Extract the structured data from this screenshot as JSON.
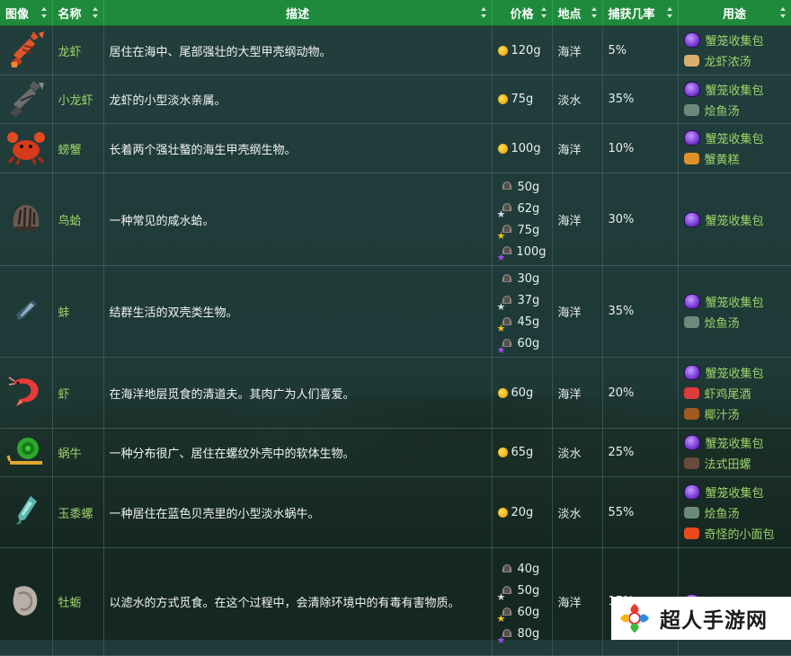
{
  "headers": {
    "image": "图像",
    "name": "名称",
    "desc": "描述",
    "price": "价格",
    "location": "地点",
    "catch_rate": "捕获几率",
    "uses": "用途"
  },
  "colors": {
    "header_bg": "#1f8a3c",
    "name_text": "#9ed36a",
    "use_text": "#9ed36a",
    "coin": "#f2a90f",
    "star_silver": "#d8dde6",
    "star_gold": "#f6c21a",
    "star_iridium": "#a34ee8"
  },
  "rows": [
    {
      "icon": "lobster-icon",
      "name": "龙虾",
      "desc": "居住在海中、尾部强壮的大型甲壳纲动物。",
      "prices": [
        {
          "quality": "base",
          "value": "120g"
        }
      ],
      "location": "海洋",
      "catch_rate": "5%",
      "uses": [
        {
          "icon": "crab-pot-icon",
          "label": "蟹笼收集包"
        },
        {
          "icon": "lobster-bisque-icon",
          "label": "龙虾浓汤"
        }
      ]
    },
    {
      "icon": "crayfish-icon",
      "name": "小龙虾",
      "desc": "龙虾的小型淡水亲属。",
      "prices": [
        {
          "quality": "base",
          "value": "75g"
        }
      ],
      "location": "淡水",
      "catch_rate": "35%",
      "uses": [
        {
          "icon": "crab-pot-icon",
          "label": "蟹笼收集包"
        },
        {
          "icon": "fish-stew-icon",
          "label": "烩鱼汤"
        }
      ]
    },
    {
      "icon": "crab-icon",
      "name": "螃蟹",
      "desc": "长着两个强壮螯的海生甲壳纲生物。",
      "prices": [
        {
          "quality": "base",
          "value": "100g"
        }
      ],
      "location": "海洋",
      "catch_rate": "10%",
      "uses": [
        {
          "icon": "crab-pot-icon",
          "label": "蟹笼收集包"
        },
        {
          "icon": "crab-cakes-icon",
          "label": "蟹黄糕"
        }
      ]
    },
    {
      "icon": "cockle-icon",
      "name": "鸟蛤",
      "desc": "一种常见的咸水蛤。",
      "prices": [
        {
          "quality": "base",
          "value": "50g"
        },
        {
          "quality": "silver",
          "value": "62g"
        },
        {
          "quality": "gold",
          "value": "75g"
        },
        {
          "quality": "iridium",
          "value": "100g"
        }
      ],
      "location": "海洋",
      "catch_rate": "30%",
      "uses": [
        {
          "icon": "crab-pot-icon",
          "label": "蟹笼收集包"
        }
      ]
    },
    {
      "icon": "mussel-icon",
      "name": "蚌",
      "desc": "结群生活的双壳类生物。",
      "prices": [
        {
          "quality": "base",
          "value": "30g"
        },
        {
          "quality": "silver",
          "value": "37g"
        },
        {
          "quality": "gold",
          "value": "45g"
        },
        {
          "quality": "iridium",
          "value": "60g"
        }
      ],
      "location": "海洋",
      "catch_rate": "35%",
      "uses": [
        {
          "icon": "crab-pot-icon",
          "label": "蟹笼收集包"
        },
        {
          "icon": "fish-stew-icon",
          "label": "烩鱼汤"
        }
      ]
    },
    {
      "icon": "shrimp-icon",
      "name": "虾",
      "desc": "在海洋地层觅食的清道夫。其肉广为人们喜爱。",
      "prices": [
        {
          "quality": "base",
          "value": "60g"
        }
      ],
      "location": "海洋",
      "catch_rate": "20%",
      "uses": [
        {
          "icon": "crab-pot-icon",
          "label": "蟹笼收集包"
        },
        {
          "icon": "shrimp-cocktail-icon",
          "label": "虾鸡尾酒"
        },
        {
          "icon": "coconut-soup-icon",
          "label": "椰汁汤"
        }
      ]
    },
    {
      "icon": "snail-icon",
      "name": "蜗牛",
      "desc": "一种分布很广、居住在螺纹外壳中的软体生物。",
      "prices": [
        {
          "quality": "base",
          "value": "65g"
        }
      ],
      "location": "淡水",
      "catch_rate": "25%",
      "uses": [
        {
          "icon": "crab-pot-icon",
          "label": "蟹笼收集包"
        },
        {
          "icon": "escargot-icon",
          "label": "法式田螺"
        }
      ]
    },
    {
      "icon": "periwinkle-icon",
      "name": "玉黍螺",
      "desc": "一种居住在蓝色贝壳里的小型淡水蜗牛。",
      "prices": [
        {
          "quality": "base",
          "value": "20g"
        }
      ],
      "location": "淡水",
      "catch_rate": "55%",
      "uses": [
        {
          "icon": "crab-pot-icon",
          "label": "蟹笼收集包"
        },
        {
          "icon": "fish-stew-icon",
          "label": "烩鱼汤"
        },
        {
          "icon": "strange-bun-icon",
          "label": "奇怪的小面包"
        }
      ]
    },
    {
      "icon": "oyster-icon",
      "name": "牡蛎",
      "desc": "以滤水的方式觅食。在这个过程中，会清除环境中的有毒有害物质。",
      "prices": [
        {
          "quality": "base",
          "value": "40g"
        },
        {
          "quality": "silver",
          "value": "50g"
        },
        {
          "quality": "gold",
          "value": "60g"
        },
        {
          "quality": "iridium",
          "value": "80g"
        }
      ],
      "location": "海洋",
      "catch_rate": "15%",
      "uses": [
        {
          "icon": "crab-pot-icon",
          "label": "蟹笼收集包"
        }
      ]
    }
  ],
  "watermark": {
    "text": "超人手游网"
  }
}
